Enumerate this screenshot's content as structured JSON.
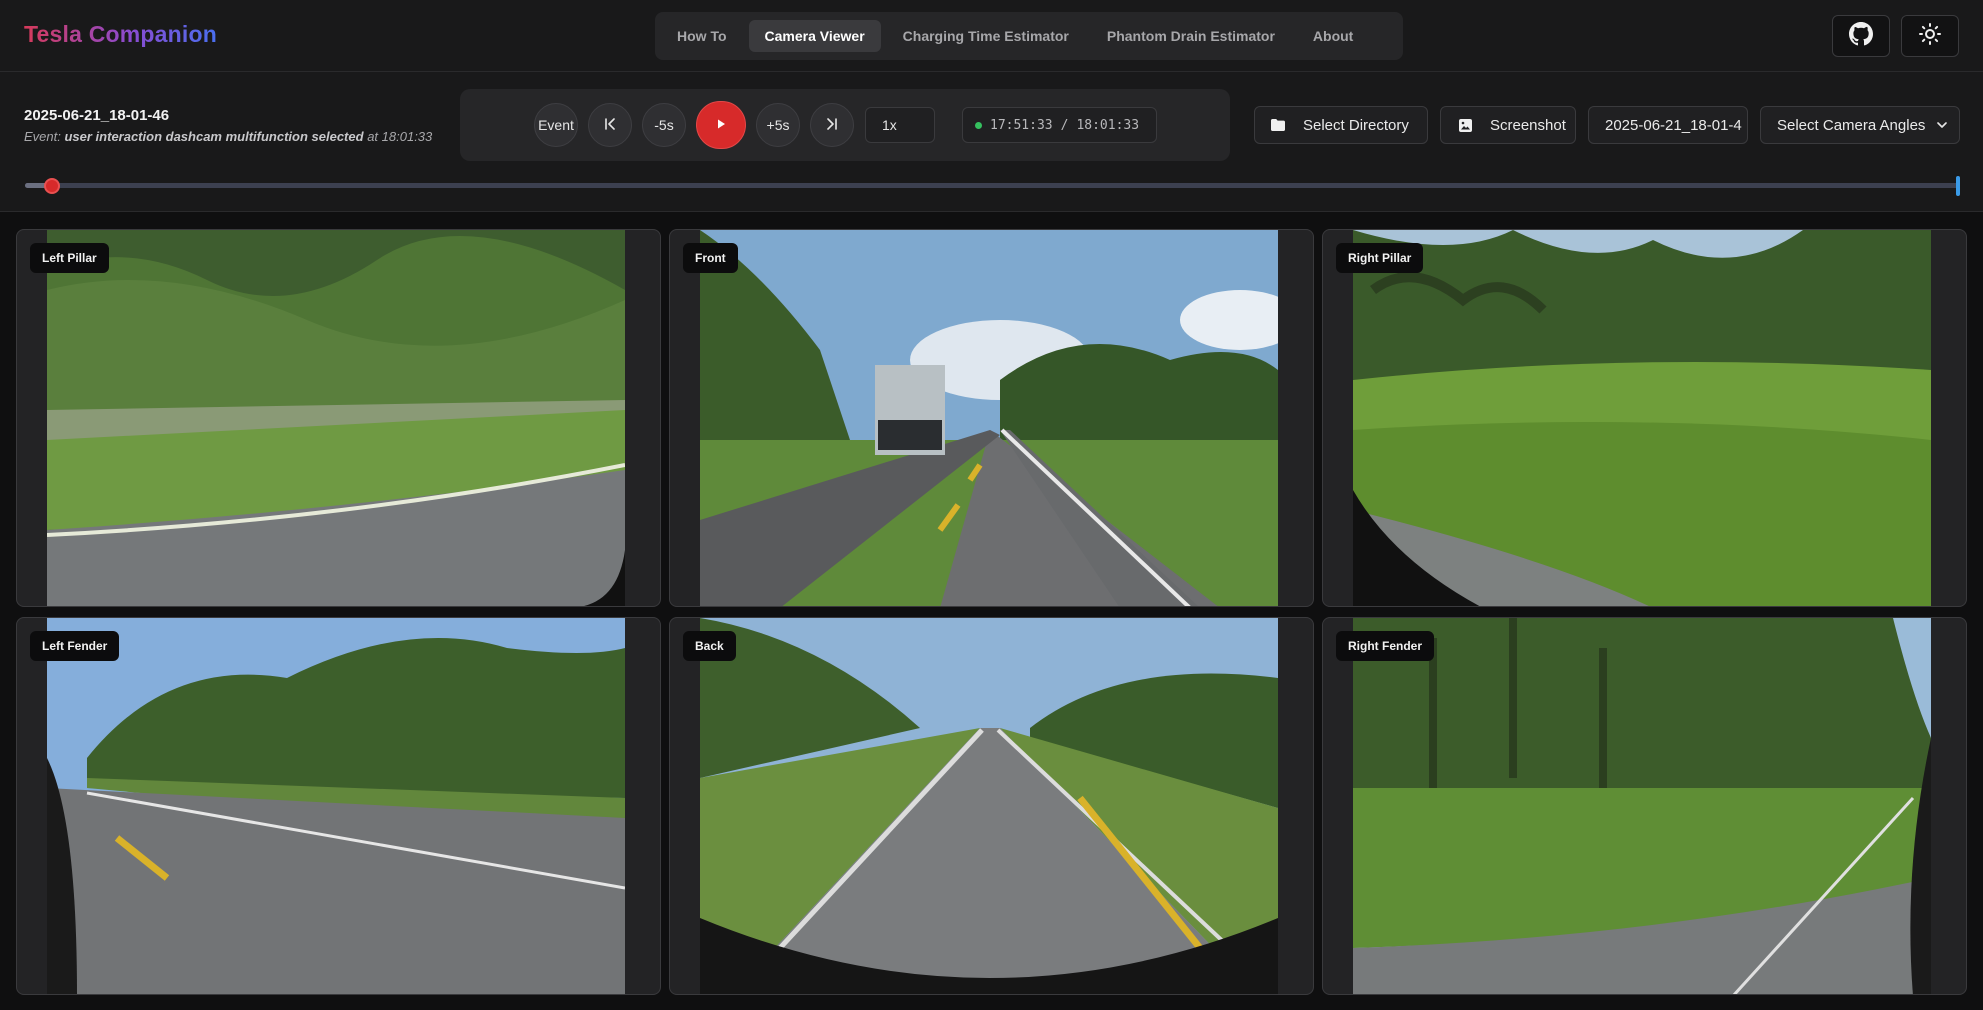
{
  "app": {
    "brand": "Tesla Companion"
  },
  "nav": {
    "tabs": [
      {
        "label": "How To"
      },
      {
        "label": "Camera Viewer",
        "active": true
      },
      {
        "label": "Charging Time Estimator"
      },
      {
        "label": "Phantom Drain Estimator"
      },
      {
        "label": "About"
      }
    ],
    "github_icon": "github-icon",
    "theme_icon": "sun-icon"
  },
  "clip": {
    "name": "2025-06-21_18-01-46",
    "event_prefix": "Event:",
    "event_reason": "user interaction dashcam multifunction selected",
    "event_at": "at",
    "event_time": "18:01:33"
  },
  "player": {
    "event_label": "Event",
    "skip_back_label": "-5s",
    "skip_fwd_label": "+5s",
    "speed": "1x",
    "current_time": "17:51:33",
    "separator": "/",
    "end_time": "18:01:33",
    "progress": 0.014
  },
  "actions": {
    "select_directory": "Select Directory",
    "screenshot": "Screenshot",
    "clip_select": "2025-06-21_18-01-4",
    "camera_angles": "Select Camera Angles"
  },
  "cameras": [
    {
      "label": "Left Pillar"
    },
    {
      "label": "Front"
    },
    {
      "label": "Right Pillar"
    },
    {
      "label": "Left Fender"
    },
    {
      "label": "Back"
    },
    {
      "label": "Right Fender"
    }
  ],
  "colors": {
    "accent_red": "#d72a2a",
    "brand_gradient": [
      "#d63a5a",
      "#8a4bd0",
      "#4a6ff0"
    ],
    "status_green": "#35c05f",
    "timeline_end": "#3b9be8"
  }
}
